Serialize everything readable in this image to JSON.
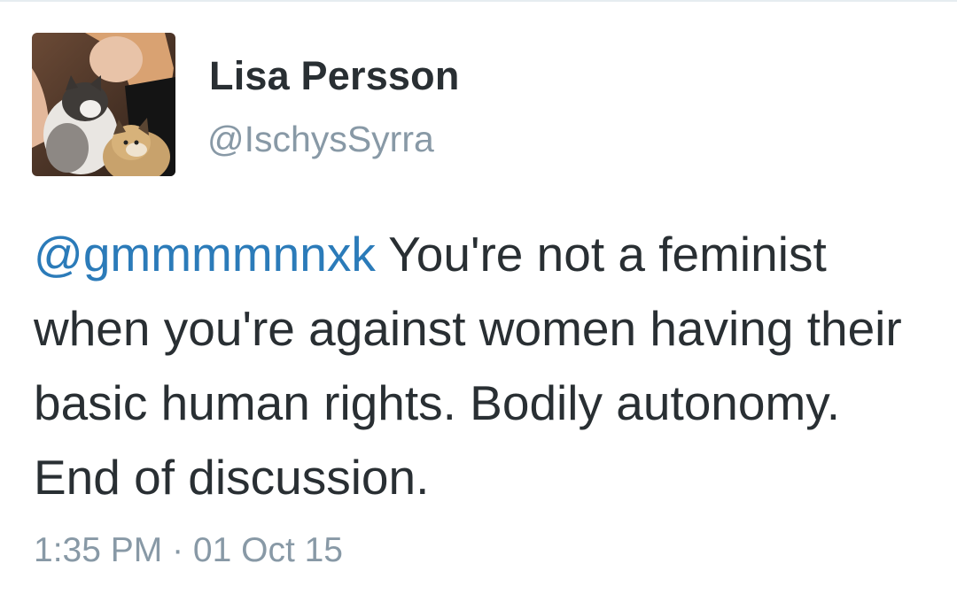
{
  "user": {
    "display_name": "Lisa Persson",
    "handle": "@IschysSyrra"
  },
  "tweet": {
    "mention": "@gmmmmnnxk",
    "text": " You're not a feminist when you're against women having their basic human rights. Bodily autonomy. End of discussion.",
    "timestamp": "1:35 PM · 01 Oct 15"
  },
  "colors": {
    "name": "#292f33",
    "secondary": "#8899a6",
    "link": "#2b7bb9",
    "background": "#ffffff"
  }
}
